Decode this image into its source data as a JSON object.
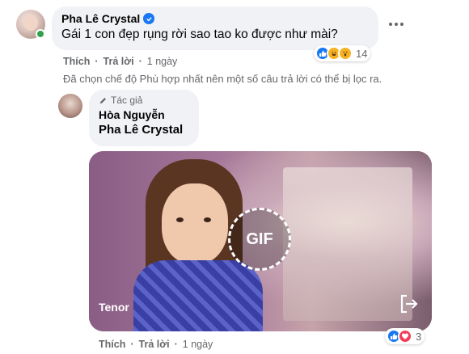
{
  "comment": {
    "author": "Pha Lê Crystal",
    "text": "Gái 1 con đẹp rụng rời sao tao ko được như mài?",
    "actions": {
      "like": "Thích",
      "reply": "Trả lời",
      "time": "1 ngày"
    },
    "reaction_count": "14",
    "reactions": [
      "like-icon",
      "haha-icon",
      "wow-icon"
    ]
  },
  "filter_note": "Đã chọn chế độ Phù hợp nhất nên một số câu trả lời có thể bị lọc ra.",
  "reply": {
    "badge": "Tác giả",
    "author": "Hòa Nguyễn",
    "mention": "Pha Lê Crystal",
    "gif": {
      "label": "GIF",
      "source": "Tenor"
    },
    "actions": {
      "like": "Thích",
      "reply": "Trả lời",
      "time": "1 ngày"
    },
    "reaction_count": "3",
    "reactions": [
      "like-icon",
      "love-icon"
    ]
  },
  "colors": {
    "bubble": "#f0f2f5",
    "meta": "#65676b",
    "like": "#1877f2",
    "love": "#f33e58",
    "online": "#31a24c"
  }
}
